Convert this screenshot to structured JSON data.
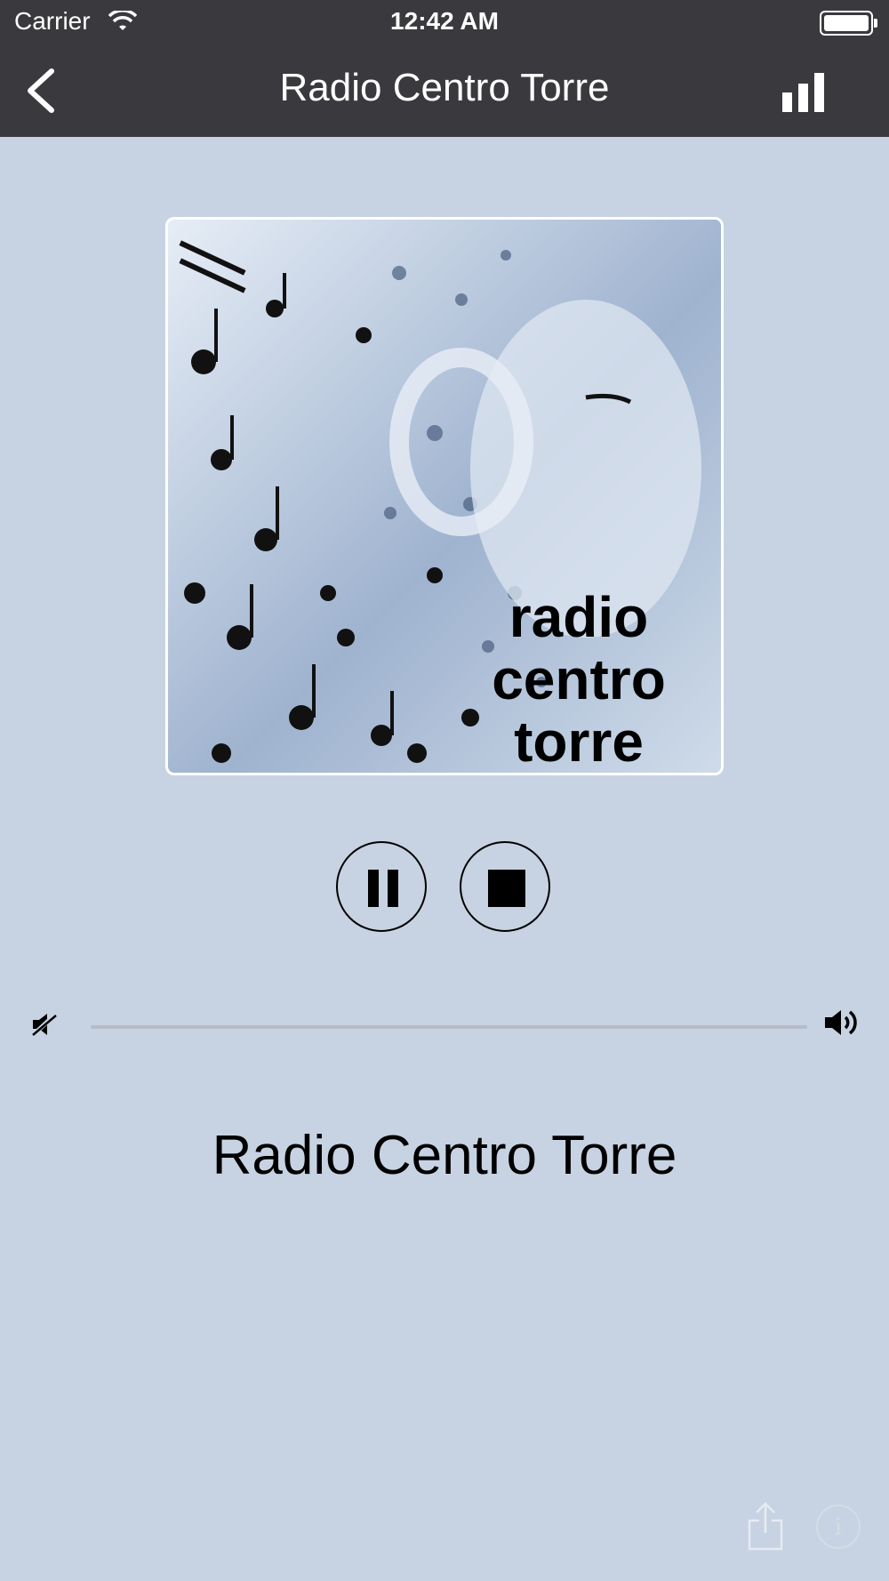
{
  "status_bar": {
    "carrier": "Carrier",
    "time": "12:42 AM"
  },
  "nav": {
    "title": "Radio Centro Torre",
    "back_icon": "chevron-left-icon",
    "stats_icon": "bar-chart-icon"
  },
  "artwork": {
    "text": "radio centro torre"
  },
  "controls": {
    "pause_icon": "pause-icon",
    "stop_icon": "stop-icon"
  },
  "volume": {
    "level": 0.0
  },
  "station": {
    "name": "Radio Centro Torre"
  },
  "colors": {
    "background": "#c7d3e2",
    "header": "#3a3a3e"
  }
}
